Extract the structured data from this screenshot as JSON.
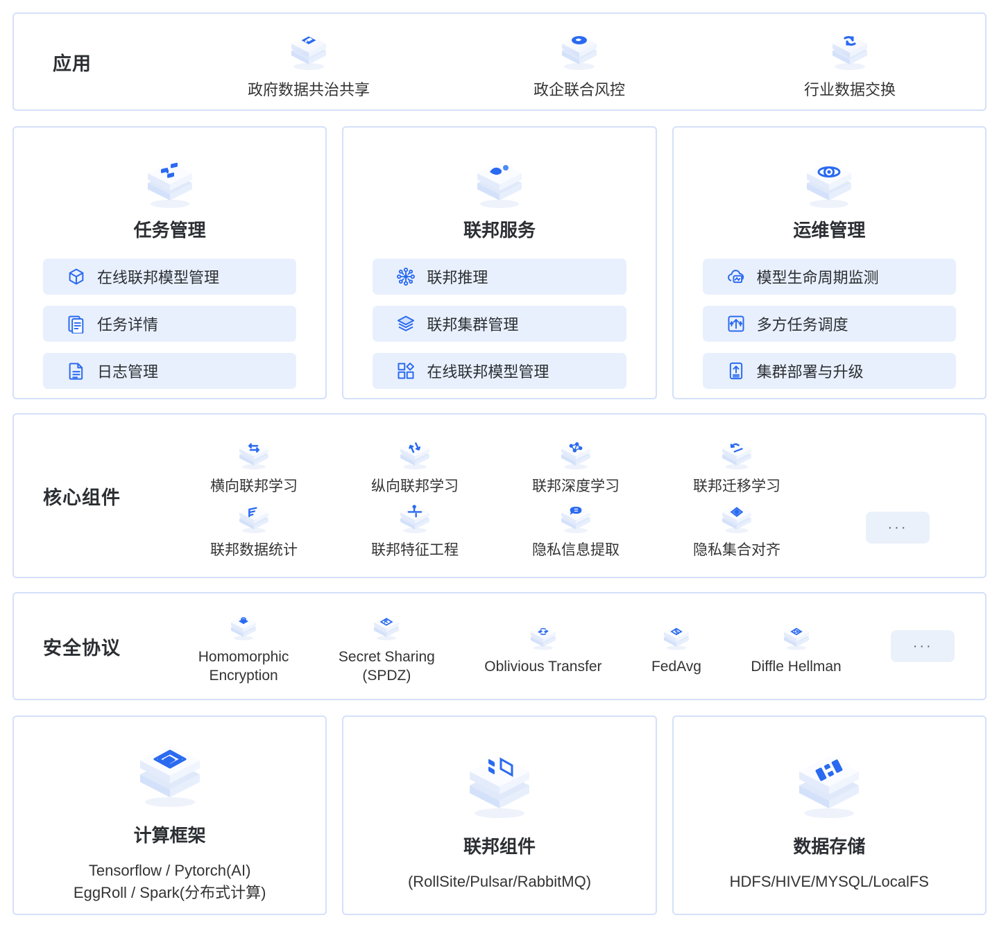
{
  "theme": {
    "border_color": "#d5e0fa",
    "pill_bg": "#e9f0fd",
    "accent_blue": "#2a6af0",
    "text_color": "#2b2f33",
    "chip_bg": "#eaf1fb"
  },
  "applications": {
    "label": "应用",
    "items": [
      {
        "caption": "政府数据共治共享",
        "icon": "app-share-icon"
      },
      {
        "caption": "政企联合风控",
        "icon": "app-riskcontrol-icon"
      },
      {
        "caption": "行业数据交换",
        "icon": "app-exchange-icon"
      }
    ]
  },
  "platform_cards": [
    {
      "title": "任务管理",
      "icon": "task-management-icon",
      "items": [
        {
          "label": "在线联邦模型管理",
          "icon": "cube-icon"
        },
        {
          "label": "任务详情",
          "icon": "documents-icon"
        },
        {
          "label": "日志管理",
          "icon": "file-lines-icon"
        }
      ]
    },
    {
      "title": "联邦服务",
      "icon": "federated-service-icon",
      "items": [
        {
          "label": "联邦推理",
          "icon": "network-node-icon"
        },
        {
          "label": "联邦集群管理",
          "icon": "layers-icon"
        },
        {
          "label": "在线联邦模型管理",
          "icon": "grid-shapes-icon"
        }
      ]
    },
    {
      "title": "运维管理",
      "icon": "ops-management-icon",
      "items": [
        {
          "label": "模型生命周期监测",
          "icon": "cloud-monitor-icon"
        },
        {
          "label": "多方任务调度",
          "icon": "arrows-updown-icon"
        },
        {
          "label": "集群部署与升级",
          "icon": "upload-box-icon"
        }
      ]
    }
  ],
  "core_components": {
    "label": "核心组件",
    "items": [
      {
        "caption": "横向联邦学习",
        "icon": "horizontal-fl-icon"
      },
      {
        "caption": "纵向联邦学习",
        "icon": "vertical-fl-icon"
      },
      {
        "caption": "联邦深度学习",
        "icon": "deep-learning-icon"
      },
      {
        "caption": "联邦迁移学习",
        "icon": "transfer-learning-icon"
      },
      {
        "caption": "联邦数据统计",
        "icon": "statistics-icon"
      },
      {
        "caption": "联邦特征工程",
        "icon": "feature-engineering-icon"
      },
      {
        "caption": "隐私信息提取",
        "icon": "privacy-extract-icon"
      },
      {
        "caption": "隐私集合对齐",
        "icon": "psi-icon"
      }
    ],
    "more": "···"
  },
  "security_protocols": {
    "label": "安全协议",
    "items": [
      {
        "caption": "Homomorphic\nEncryption",
        "icon": "lock-icon"
      },
      {
        "caption": "Secret Sharing\n(SPDZ)",
        "icon": "secret-share-icon"
      },
      {
        "caption": "Oblivious Transfer",
        "icon": "transfer-icon"
      },
      {
        "caption": "FedAvg",
        "icon": "fedavg-icon"
      },
      {
        "caption": "Diffle Hellman",
        "icon": "diffie-hellman-icon"
      }
    ],
    "more": "···"
  },
  "infrastructure": [
    {
      "title": "计算框架",
      "subtitle": "Tensorflow / Pytorch(AI)\nEggRoll / Spark(分布式计算)",
      "icon": "compute-framework-icon"
    },
    {
      "title": "联邦组件",
      "subtitle": "(RollSite/Pulsar/RabbitMQ)",
      "icon": "federated-component-icon"
    },
    {
      "title": "数据存储",
      "subtitle": "HDFS/HIVE/MYSQL/LocalFS",
      "icon": "data-storage-icon"
    }
  ]
}
